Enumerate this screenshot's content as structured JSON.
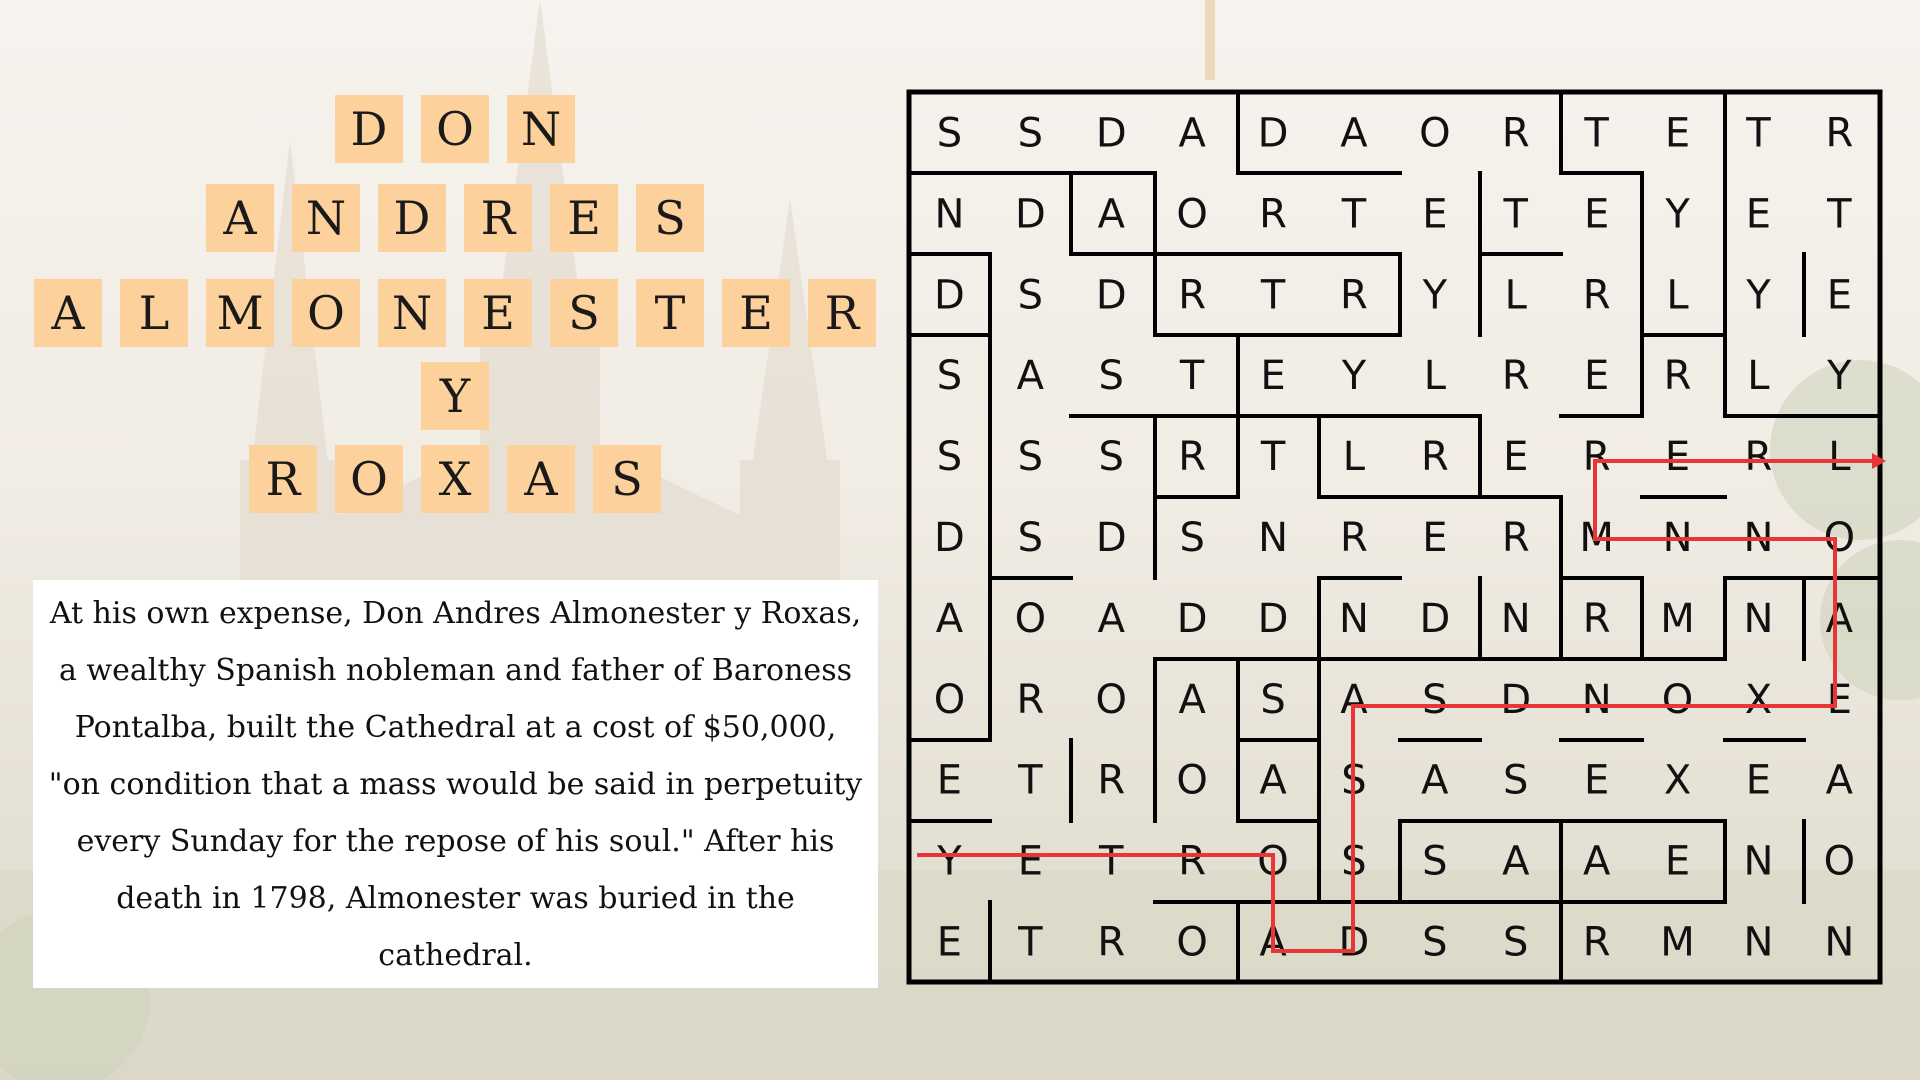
{
  "title_lines": [
    [
      "D",
      "O",
      "N"
    ],
    [
      "A",
      "N",
      "D",
      "R",
      "E",
      "S"
    ],
    [
      "A",
      "L",
      "M",
      "O",
      "N",
      "E",
      "S",
      "T",
      "E",
      "R"
    ],
    [
      "Y"
    ],
    [
      "R",
      "O",
      "X",
      "A",
      "S"
    ]
  ],
  "caption": "At his own expense, Don Andres Almonester y Roxas, a wealthy Spanish nobleman and father of Baroness Pontalba, built the Cathedral at a cost of $50,000, \"on condition that a mass would be said in perpetuity every Sunday for the repose of his soul.\" After his death in 1798, Almonester was buried in the cathedral.",
  "grid": [
    [
      "S",
      "S",
      "D",
      "A",
      "D",
      "A",
      "O",
      "R",
      "T",
      "E",
      "T",
      "R"
    ],
    [
      "N",
      "D",
      "A",
      "O",
      "R",
      "T",
      "E",
      "T",
      "E",
      "Y",
      "E",
      "T"
    ],
    [
      "D",
      "S",
      "D",
      "R",
      "T",
      "R",
      "Y",
      "L",
      "R",
      "L",
      "Y",
      "E"
    ],
    [
      "S",
      "A",
      "S",
      "T",
      "E",
      "Y",
      "L",
      "R",
      "E",
      "R",
      "L",
      "Y"
    ],
    [
      "S",
      "S",
      "S",
      "R",
      "T",
      "L",
      "R",
      "E",
      "R",
      "E",
      "R",
      "L"
    ],
    [
      "D",
      "S",
      "D",
      "S",
      "N",
      "R",
      "E",
      "R",
      "M",
      "N",
      "N",
      "O"
    ],
    [
      "A",
      "O",
      "A",
      "D",
      "D",
      "N",
      "D",
      "N",
      "R",
      "M",
      "N",
      "A"
    ],
    [
      "O",
      "R",
      "O",
      "A",
      "S",
      "A",
      "S",
      "D",
      "N",
      "O",
      "X",
      "E"
    ],
    [
      "E",
      "T",
      "R",
      "O",
      "A",
      "S",
      "A",
      "S",
      "E",
      "X",
      "E",
      "A"
    ],
    [
      "Y",
      "E",
      "T",
      "R",
      "O",
      "S",
      "S",
      "A",
      "A",
      "E",
      "N",
      "O"
    ],
    [
      "E",
      "T",
      "R",
      "O",
      "A",
      "D",
      "S",
      "S",
      "R",
      "M",
      "N",
      "N"
    ]
  ],
  "colors": {
    "tile": "#fdd19b",
    "path": "#e83535",
    "wall": "#000000"
  }
}
